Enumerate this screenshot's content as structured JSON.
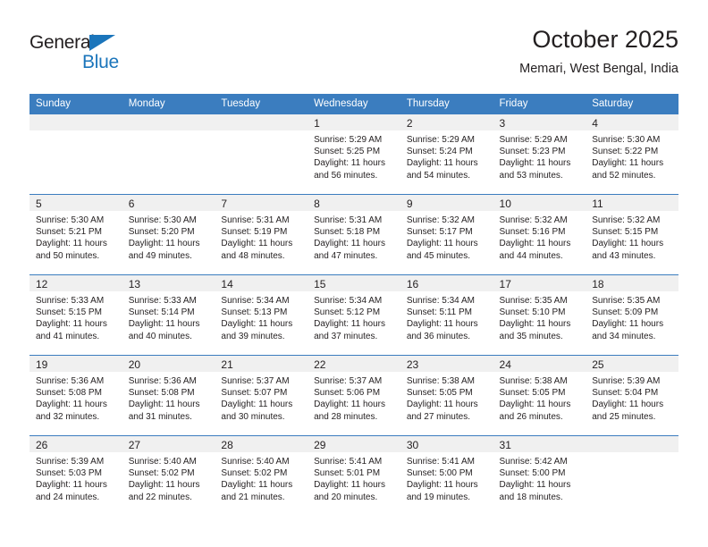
{
  "brand": {
    "name_top": "General",
    "name_bottom": "Blue",
    "accent_color": "#1b75bb"
  },
  "header": {
    "title": "October 2025",
    "subtitle": "Memari, West Bengal, India"
  },
  "calendar": {
    "header_bg": "#3b7dbf",
    "day_band_bg": "#f0f0f0",
    "weekdays": [
      "Sunday",
      "Monday",
      "Tuesday",
      "Wednesday",
      "Thursday",
      "Friday",
      "Saturday"
    ],
    "weeks": [
      [
        {
          "day": "",
          "lines": []
        },
        {
          "day": "",
          "lines": []
        },
        {
          "day": "",
          "lines": []
        },
        {
          "day": "1",
          "lines": [
            "Sunrise: 5:29 AM",
            "Sunset: 5:25 PM",
            "Daylight: 11 hours",
            "and 56 minutes."
          ]
        },
        {
          "day": "2",
          "lines": [
            "Sunrise: 5:29 AM",
            "Sunset: 5:24 PM",
            "Daylight: 11 hours",
            "and 54 minutes."
          ]
        },
        {
          "day": "3",
          "lines": [
            "Sunrise: 5:29 AM",
            "Sunset: 5:23 PM",
            "Daylight: 11 hours",
            "and 53 minutes."
          ]
        },
        {
          "day": "4",
          "lines": [
            "Sunrise: 5:30 AM",
            "Sunset: 5:22 PM",
            "Daylight: 11 hours",
            "and 52 minutes."
          ]
        }
      ],
      [
        {
          "day": "5",
          "lines": [
            "Sunrise: 5:30 AM",
            "Sunset: 5:21 PM",
            "Daylight: 11 hours",
            "and 50 minutes."
          ]
        },
        {
          "day": "6",
          "lines": [
            "Sunrise: 5:30 AM",
            "Sunset: 5:20 PM",
            "Daylight: 11 hours",
            "and 49 minutes."
          ]
        },
        {
          "day": "7",
          "lines": [
            "Sunrise: 5:31 AM",
            "Sunset: 5:19 PM",
            "Daylight: 11 hours",
            "and 48 minutes."
          ]
        },
        {
          "day": "8",
          "lines": [
            "Sunrise: 5:31 AM",
            "Sunset: 5:18 PM",
            "Daylight: 11 hours",
            "and 47 minutes."
          ]
        },
        {
          "day": "9",
          "lines": [
            "Sunrise: 5:32 AM",
            "Sunset: 5:17 PM",
            "Daylight: 11 hours",
            "and 45 minutes."
          ]
        },
        {
          "day": "10",
          "lines": [
            "Sunrise: 5:32 AM",
            "Sunset: 5:16 PM",
            "Daylight: 11 hours",
            "and 44 minutes."
          ]
        },
        {
          "day": "11",
          "lines": [
            "Sunrise: 5:32 AM",
            "Sunset: 5:15 PM",
            "Daylight: 11 hours",
            "and 43 minutes."
          ]
        }
      ],
      [
        {
          "day": "12",
          "lines": [
            "Sunrise: 5:33 AM",
            "Sunset: 5:15 PM",
            "Daylight: 11 hours",
            "and 41 minutes."
          ]
        },
        {
          "day": "13",
          "lines": [
            "Sunrise: 5:33 AM",
            "Sunset: 5:14 PM",
            "Daylight: 11 hours",
            "and 40 minutes."
          ]
        },
        {
          "day": "14",
          "lines": [
            "Sunrise: 5:34 AM",
            "Sunset: 5:13 PM",
            "Daylight: 11 hours",
            "and 39 minutes."
          ]
        },
        {
          "day": "15",
          "lines": [
            "Sunrise: 5:34 AM",
            "Sunset: 5:12 PM",
            "Daylight: 11 hours",
            "and 37 minutes."
          ]
        },
        {
          "day": "16",
          "lines": [
            "Sunrise: 5:34 AM",
            "Sunset: 5:11 PM",
            "Daylight: 11 hours",
            "and 36 minutes."
          ]
        },
        {
          "day": "17",
          "lines": [
            "Sunrise: 5:35 AM",
            "Sunset: 5:10 PM",
            "Daylight: 11 hours",
            "and 35 minutes."
          ]
        },
        {
          "day": "18",
          "lines": [
            "Sunrise: 5:35 AM",
            "Sunset: 5:09 PM",
            "Daylight: 11 hours",
            "and 34 minutes."
          ]
        }
      ],
      [
        {
          "day": "19",
          "lines": [
            "Sunrise: 5:36 AM",
            "Sunset: 5:08 PM",
            "Daylight: 11 hours",
            "and 32 minutes."
          ]
        },
        {
          "day": "20",
          "lines": [
            "Sunrise: 5:36 AM",
            "Sunset: 5:08 PM",
            "Daylight: 11 hours",
            "and 31 minutes."
          ]
        },
        {
          "day": "21",
          "lines": [
            "Sunrise: 5:37 AM",
            "Sunset: 5:07 PM",
            "Daylight: 11 hours",
            "and 30 minutes."
          ]
        },
        {
          "day": "22",
          "lines": [
            "Sunrise: 5:37 AM",
            "Sunset: 5:06 PM",
            "Daylight: 11 hours",
            "and 28 minutes."
          ]
        },
        {
          "day": "23",
          "lines": [
            "Sunrise: 5:38 AM",
            "Sunset: 5:05 PM",
            "Daylight: 11 hours",
            "and 27 minutes."
          ]
        },
        {
          "day": "24",
          "lines": [
            "Sunrise: 5:38 AM",
            "Sunset: 5:05 PM",
            "Daylight: 11 hours",
            "and 26 minutes."
          ]
        },
        {
          "day": "25",
          "lines": [
            "Sunrise: 5:39 AM",
            "Sunset: 5:04 PM",
            "Daylight: 11 hours",
            "and 25 minutes."
          ]
        }
      ],
      [
        {
          "day": "26",
          "lines": [
            "Sunrise: 5:39 AM",
            "Sunset: 5:03 PM",
            "Daylight: 11 hours",
            "and 24 minutes."
          ]
        },
        {
          "day": "27",
          "lines": [
            "Sunrise: 5:40 AM",
            "Sunset: 5:02 PM",
            "Daylight: 11 hours",
            "and 22 minutes."
          ]
        },
        {
          "day": "28",
          "lines": [
            "Sunrise: 5:40 AM",
            "Sunset: 5:02 PM",
            "Daylight: 11 hours",
            "and 21 minutes."
          ]
        },
        {
          "day": "29",
          "lines": [
            "Sunrise: 5:41 AM",
            "Sunset: 5:01 PM",
            "Daylight: 11 hours",
            "and 20 minutes."
          ]
        },
        {
          "day": "30",
          "lines": [
            "Sunrise: 5:41 AM",
            "Sunset: 5:00 PM",
            "Daylight: 11 hours",
            "and 19 minutes."
          ]
        },
        {
          "day": "31",
          "lines": [
            "Sunrise: 5:42 AM",
            "Sunset: 5:00 PM",
            "Daylight: 11 hours",
            "and 18 minutes."
          ]
        },
        {
          "day": "",
          "lines": []
        }
      ]
    ]
  }
}
